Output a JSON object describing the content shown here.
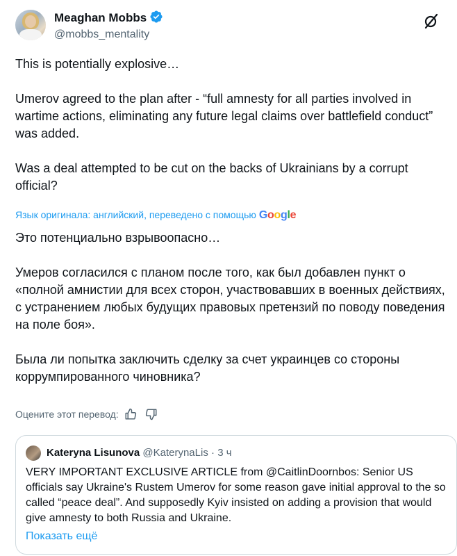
{
  "author": {
    "name": "Meaghan Mobbs",
    "handle": "@mobbs_mentality"
  },
  "original_text": [
    "This is potentially explosive…",
    "Umerov agreed to the plan after - “full amnesty for all parties involved in wartime actions, eliminating any future legal claims over battlefield conduct” was added.",
    "Was a deal attempted to be cut on the backs of Ukrainians by a corrupt official?"
  ],
  "translation_note": "Язык оригинала: английский, переведено с помощью",
  "translation_provider": "Google",
  "translated_text": [
    "Это потенциально взрывоопасно…",
    "Умеров согласился с планом после того, как был добавлен пункт о «полной амнистии для всех сторон, участвовавших в военных действиях, с устранением любых будущих правовых претензий по поводу поведения на поле боя».",
    "Была ли попытка заключить сделку за счет украинцев со стороны коррумпированного чиновника?"
  ],
  "rate_translation_label": "Оцените этот перевод:",
  "quote": {
    "name": "Kateryna Lisunova",
    "handle": "@KaterynaLis",
    "separator": "·",
    "time": "3 ч",
    "text": "VERY IMPORTANT EXCLUSIVE ARTICLE from @CaitlinDoornbos: Senior US officials say Ukraine's Rustem Umerov for some reason gave initial approval to the so called “peace deal”. And supposedly Kyiv insisted on adding a provision that would give amnesty to both Russia and Ukraine.",
    "show_more": "Показать ещё"
  },
  "colors": {
    "accent": "#1d9bf0",
    "secondary_text": "#536471",
    "border": "#cfd9de"
  },
  "icons": [
    "verified-badge-icon",
    "grok-icon",
    "thumbs-up-icon",
    "thumbs-down-icon"
  ]
}
